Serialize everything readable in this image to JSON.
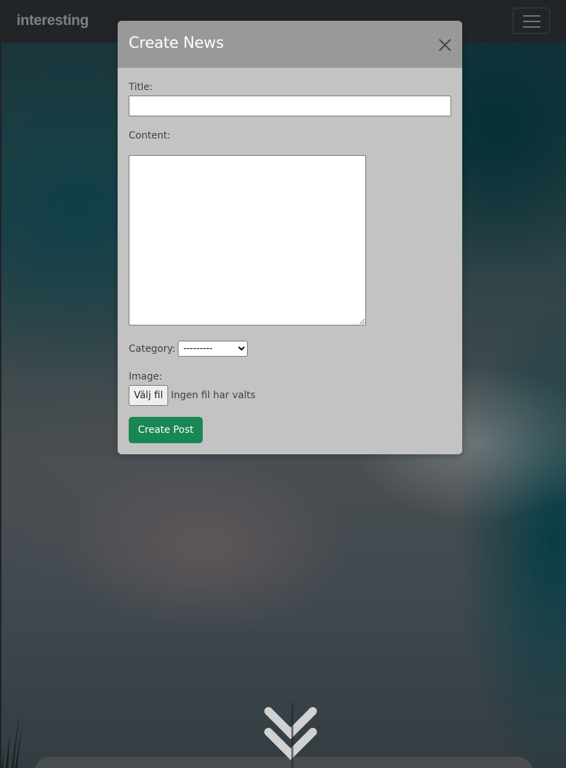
{
  "navbar": {
    "brand": "interesting",
    "toggler_icon": "hamburger-menu-icon"
  },
  "modal": {
    "title": "Create News",
    "close_icon": "close-icon",
    "form": {
      "title_label": "Title:",
      "title_value": "",
      "content_label": "Content:",
      "content_value": "",
      "category_label": "Category:",
      "category_selected": "---------",
      "image_label": "Image:",
      "file_button_label": "Välj fil",
      "file_status": "Ingen fil har valts",
      "submit_label": "Create Post"
    }
  },
  "background": {
    "scroll_icon": "double-chevron-down-icon"
  },
  "colors": {
    "navbar_bg": "#2a2e31",
    "modal_header_bg": "#999999",
    "modal_body_bg": "#c3c3c3",
    "submit_bg": "#198754"
  }
}
